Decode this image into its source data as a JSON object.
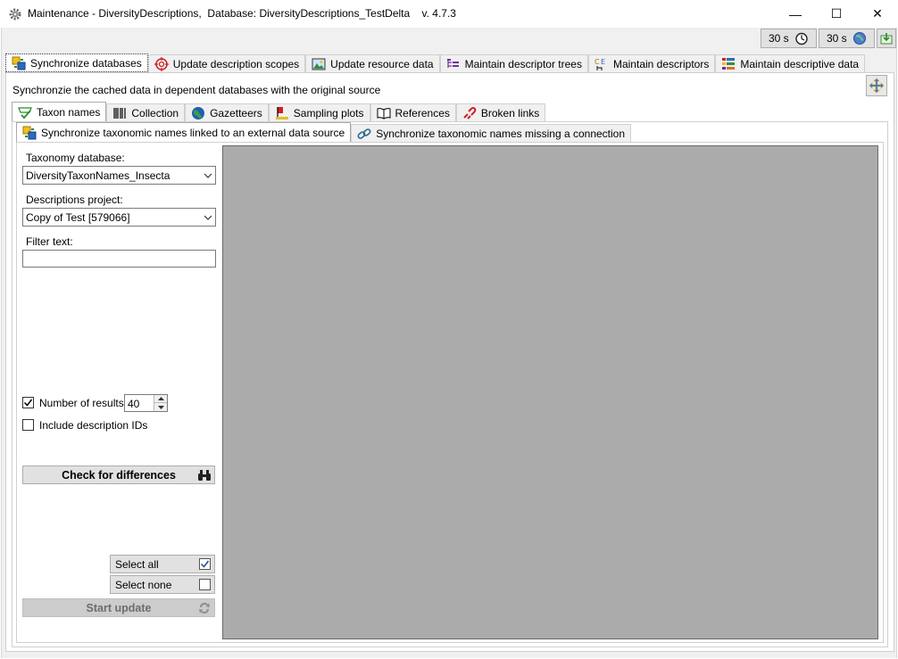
{
  "window": {
    "title": "Maintenance - DiversityDescriptions,  Database: DiversityDescriptions_TestDelta    v. 4.7.3",
    "minimize": "—",
    "maximize": "☐",
    "close": "✕"
  },
  "toolbar": {
    "timer1": "30 s",
    "timer2": "30 s"
  },
  "main_tabs": [
    {
      "label": "Synchronize databases",
      "icon": "sync-databases-icon"
    },
    {
      "label": "Update description scopes",
      "icon": "target-icon"
    },
    {
      "label": "Update resource data",
      "icon": "image-icon"
    },
    {
      "label": "Maintain descriptor trees",
      "icon": "tree-icon"
    },
    {
      "label": "Maintain descriptors",
      "icon": "descriptors-icon"
    },
    {
      "label": "Maintain descriptive data",
      "icon": "data-grid-icon"
    }
  ],
  "info_text": "Synchronzie the cached data in dependent databases with the original source",
  "sub_tabs": [
    {
      "label": "Taxon names",
      "icon": "taxon-icon"
    },
    {
      "label": "Collection",
      "icon": "barcode-icon"
    },
    {
      "label": "Gazetteers",
      "icon": "globe-icon"
    },
    {
      "label": "Sampling plots",
      "icon": "plot-icon"
    },
    {
      "label": "References",
      "icon": "book-icon"
    },
    {
      "label": "Broken links",
      "icon": "broken-link-icon"
    }
  ],
  "inner_tabs": [
    {
      "label": "Synchronize taxonomic names linked to an external data source",
      "icon": "sync-icon"
    },
    {
      "label": "Synchronize taxonomic names missing a connection",
      "icon": "link-icon"
    }
  ],
  "form": {
    "taxonomy_label": "Taxonomy database:",
    "taxonomy_value": "DiversityTaxonNames_Insecta",
    "project_label": "Descriptions project:",
    "project_value": "Copy of Test [579066]",
    "filter_label": "Filter text:",
    "filter_value": "",
    "num_results_label": "Number of results:",
    "num_results_value": "40",
    "num_results_checked": true,
    "include_ids_label": "Include description IDs",
    "include_ids_checked": false,
    "check_button": "Check for differences",
    "select_all": "Select all",
    "select_none": "Select none",
    "start_update": "Start update"
  }
}
